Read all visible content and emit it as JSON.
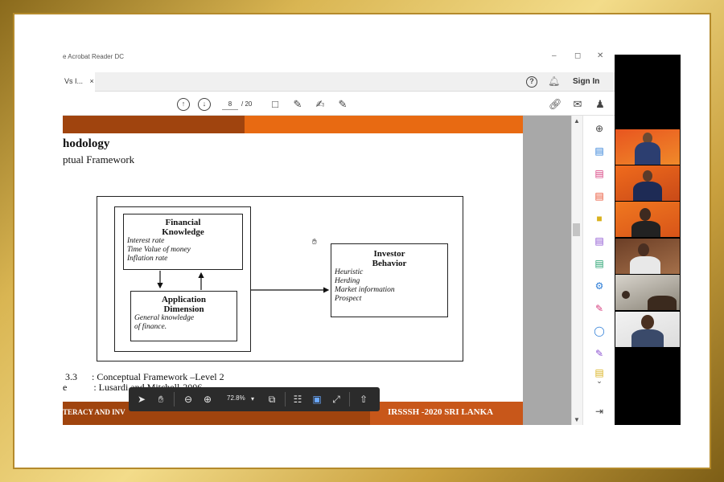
{
  "window": {
    "title": "e Acrobat Reader DC",
    "controls": [
      "–",
      "◻",
      "✕"
    ]
  },
  "tabs": [
    {
      "label": "Vs I...",
      "close": "×"
    }
  ],
  "header": {
    "help_icon": "?",
    "sign_in": "Sign In"
  },
  "toolbar": {
    "current_page": "8",
    "page_total": "/ 20"
  },
  "slide": {
    "heading": "hodology",
    "subheading": "ptual Framework",
    "diagram": {
      "financial_title": "Financial\nKnowledge",
      "financial_items": [
        "Interest rate",
        "Time Value of money",
        "Inflation rate"
      ],
      "application_title": "Application\nDimension",
      "application_items": [
        "General knowledge",
        "of finance."
      ],
      "investor_title": "Investor\nBehavior",
      "investor_items": [
        "Heuristic",
        "Herding",
        "Market information",
        "Prospect"
      ]
    },
    "caption_line1": " 3.3      : Conceptual Framework –Level 2",
    "caption_line2": "e           : Lusardi and Mitchell-2006",
    "footer_left": "TERACY AND INV",
    "footer_right": "IRSSSH -2020 SRI LANKA"
  },
  "floating_toolbar": {
    "zoom": "72.8%"
  },
  "colors": {
    "slide_dark": "#a0440e",
    "slide_orange": "#e86a12",
    "right_panel_accents": [
      "#2a7bd6",
      "#d63a7c",
      "#e84b2b",
      "#d9b21e",
      "#8a4fd0",
      "#1e9e6a"
    ]
  }
}
